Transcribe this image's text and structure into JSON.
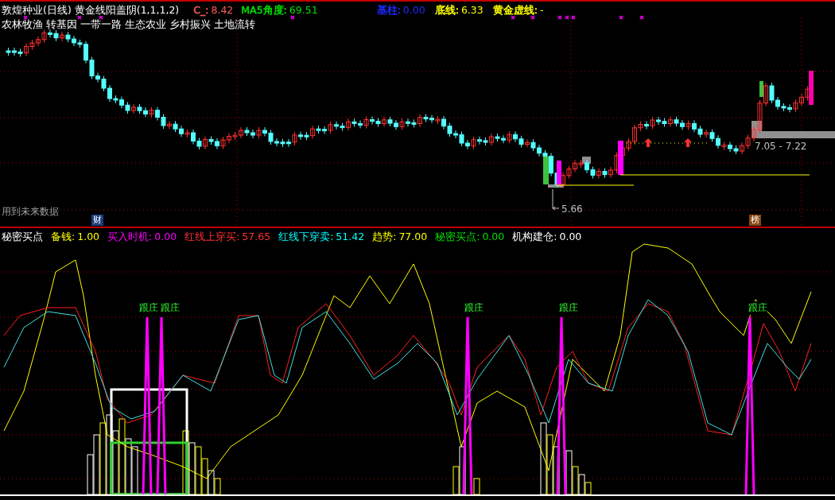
{
  "top_panel": {
    "stock": "敦煌种业(日线)",
    "indicator": "黄金线阳盖阴(1,1,1,2)",
    "readouts": [
      {
        "label": "C_:",
        "value": "8.42",
        "color": "#ff5a5a"
      },
      {
        "label": "MA5角度:",
        "value": "69.51",
        "color": "#00e000"
      },
      {
        "label": "基柱:",
        "value": "0.00",
        "color": "#1f2cff"
      },
      {
        "label": "底线:",
        "value": "6.33",
        "color": "#ffff00"
      },
      {
        "label": "黄金虚线:",
        "value": "-",
        "color": "#ffff00"
      }
    ],
    "concepts": "农林牧渔 转基因 一带一路 生态农业 乡村振兴 土地流转",
    "future_note": "用到未来数据",
    "low_price": "5.66",
    "range_label": "7.05 - 7.22",
    "badges": [
      {
        "text": "财",
        "color": "#1c3f7c"
      },
      {
        "text": "榜",
        "color": "#8a4a10"
      }
    ]
  },
  "bottom_panel": {
    "title": "秘密买点",
    "readouts": [
      {
        "label": "备钱:",
        "value": "1.00",
        "color": "#ffff00"
      },
      {
        "label": "买入时机:",
        "value": "0.00",
        "color": "#ff00ff"
      },
      {
        "label": "红线上穿买:",
        "value": "57.65",
        "color": "#ff3030"
      },
      {
        "label": "红线下穿卖:",
        "value": "51.42",
        "color": "#00ffff"
      },
      {
        "label": "趋势:",
        "value": "77.00",
        "color": "#ffff00"
      },
      {
        "label": "秘密买点:",
        "value": "0.00",
        "color": "#00e000"
      },
      {
        "label": "机构建仓:",
        "value": "0.00",
        "color": "#ffffff"
      }
    ],
    "signals": [
      "跟庄",
      "跟庄",
      "跟庄",
      "跟庄",
      "跟庄"
    ]
  }
}
